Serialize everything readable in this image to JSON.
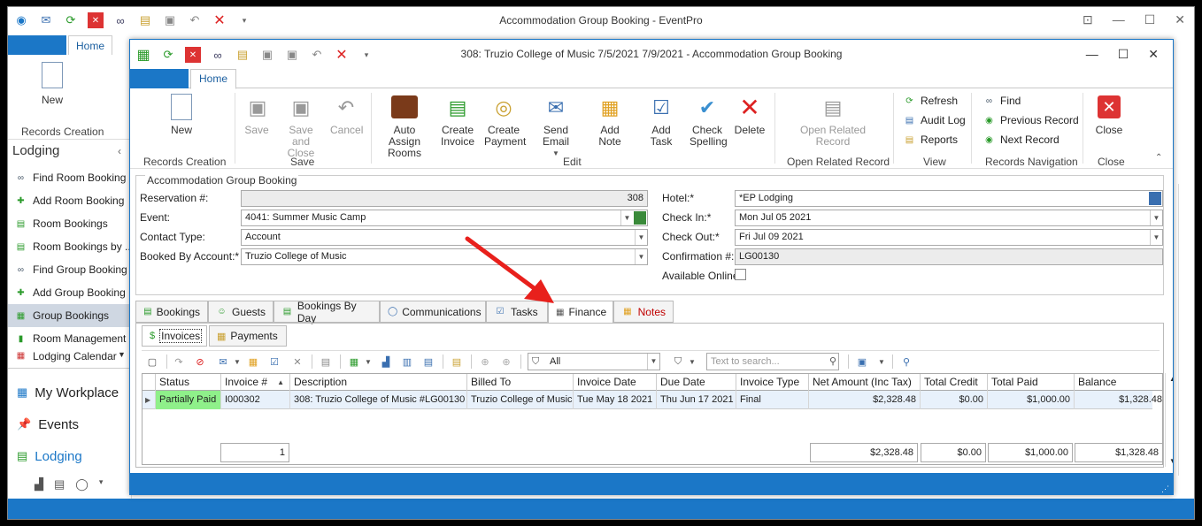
{
  "outer_window": {
    "title": "Accommodation Group Booking - EventPro",
    "home_tab": "Home",
    "new_label": "New",
    "records_creation_label": "Records Creation",
    "sidebar_header": "Lodging",
    "sidebar_items": [
      {
        "label": "Find Room Booking",
        "icon": "binoculars-icon"
      },
      {
        "label": "Add Room Booking",
        "icon": "add-icon"
      },
      {
        "label": "Room Bookings",
        "icon": "list-icon"
      },
      {
        "label": "Room Bookings by ...",
        "icon": "list-icon"
      },
      {
        "label": "Find Group Booking",
        "icon": "binoculars-icon"
      },
      {
        "label": "Add Group Booking",
        "icon": "add-icon"
      },
      {
        "label": "Group Bookings",
        "icon": "grid-icon"
      },
      {
        "label": "Room Management",
        "icon": "door-icon"
      },
      {
        "label": "Lodging Calendar",
        "icon": "calendar-icon"
      }
    ],
    "nav": [
      {
        "label": "My Workplace"
      },
      {
        "label": "Events"
      },
      {
        "label": "Lodging"
      }
    ]
  },
  "inner_window": {
    "title": "308: Truzio College of Music 7/5/2021 7/9/2021 - Accommodation Group Booking",
    "home_tab": "Home",
    "ribbon": {
      "new": "New",
      "save": "Save",
      "save_close": "Save and Close",
      "cancel": "Cancel",
      "auto_assign": "Auto Assign Rooms",
      "create_invoice": "Create Invoice",
      "create_payment": "Create Payment",
      "send_email": "Send Email",
      "add_note": "Add Note",
      "add_task": "Add Task",
      "check_spelling": "Check Spelling",
      "delete": "Delete",
      "open_related": "Open Related Record",
      "refresh": "Refresh",
      "audit_log": "Audit Log",
      "reports": "Reports",
      "find": "Find",
      "previous_record": "Previous Record",
      "next_record": "Next Record",
      "close": "Close",
      "groups": {
        "records_creation": "Records Creation",
        "save": "Save",
        "edit": "Edit",
        "open_related": "Open Related Record",
        "view": "View",
        "records_navigation": "Records Navigation",
        "close": "Close"
      }
    },
    "form": {
      "section_title": "Accommodation Group Booking",
      "reservation_label": "Reservation #:",
      "reservation_value": "308",
      "event_label": "Event:",
      "event_value": "4041: Summer Music Camp",
      "contact_type_label": "Contact Type:",
      "contact_type_value": "Account",
      "booked_by_label": "Booked By Account:*",
      "booked_by_value": "Truzio College of Music",
      "hotel_label": "Hotel:*",
      "hotel_value": "*EP Lodging",
      "check_in_label": "Check In:*",
      "check_in_value": "Mon Jul 05 2021",
      "check_out_label": "Check Out:*",
      "check_out_value": "Fri Jul 09 2021",
      "confirmation_label": "Confirmation #:",
      "confirmation_value": "LG00130",
      "available_online_label": "Available Online"
    },
    "tabs": [
      "Bookings",
      "Guests",
      "Bookings By Day",
      "Communications",
      "Tasks",
      "Finance",
      "Notes"
    ],
    "active_tab": "Finance",
    "subtabs": [
      "Invoices",
      "Payments"
    ],
    "grid": {
      "filter_value": "All",
      "search_placeholder": "Text to search...",
      "columns": [
        "Status",
        "Invoice #",
        "Description",
        "Billed To",
        "Invoice Date",
        "Due Date",
        "Invoice Type",
        "Net Amount (Inc Tax)",
        "Total Credit",
        "Total Paid",
        "Balance"
      ],
      "rows": [
        {
          "status": "Partially Paid",
          "invoice_no": "I000302",
          "description": "308: Truzio College of Music #LG00130",
          "billed_to": "Truzio College of Music",
          "invoice_date": "Tue May 18 2021",
          "due_date": "Thu Jun 17 2021",
          "invoice_type": "Final",
          "net_amount": "$2,328.48",
          "total_credit": "$0.00",
          "total_paid": "$1,000.00",
          "balance": "$1,328.48"
        }
      ],
      "footer": {
        "count": "1",
        "net_amount": "$2,328.48",
        "total_credit": "$0.00",
        "total_paid": "$1,000.00",
        "balance": "$1,328.48"
      }
    }
  },
  "colors": {
    "accent": "#1b77c7",
    "status_partial": "#8ff08a",
    "annotation_arrow": "#e8201c",
    "notes_text": "#c00000"
  }
}
